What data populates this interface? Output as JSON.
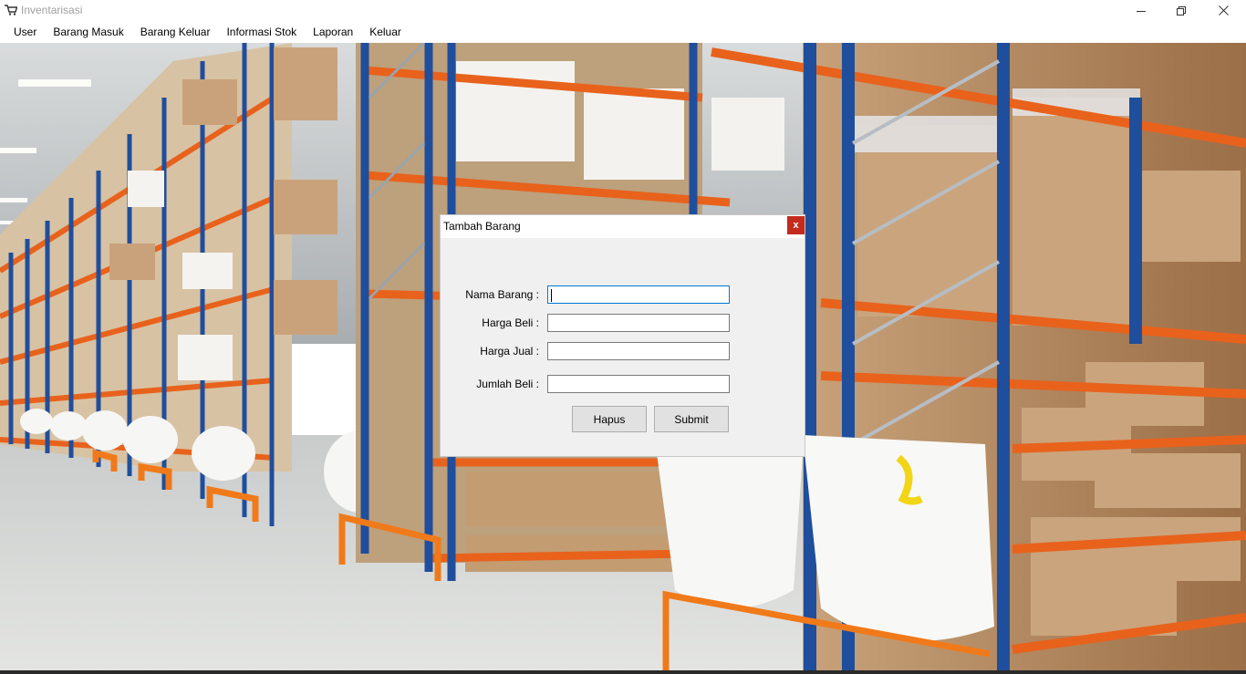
{
  "window": {
    "title": "Inventarisasi",
    "icon": "cart-icon",
    "controls": [
      "minimize-icon",
      "restore-icon",
      "close-icon"
    ]
  },
  "menu": {
    "items": [
      {
        "label": "User"
      },
      {
        "label": "Barang Masuk"
      },
      {
        "label": "Barang Keluar"
      },
      {
        "label": "Informasi Stok"
      },
      {
        "label": "Laporan"
      },
      {
        "label": "Keluar"
      }
    ]
  },
  "background": {
    "description_icon": "warehouse-background-image"
  },
  "dialog": {
    "title": "Tambah Barang",
    "close_label": "x",
    "fields": [
      {
        "label": "Nama Barang :",
        "value": "",
        "focused": true
      },
      {
        "label": "Harga Beli :",
        "value": ""
      },
      {
        "label": "Harga Jual :",
        "value": ""
      },
      {
        "label": "Jumlah Beli :",
        "value": ""
      }
    ],
    "buttons": {
      "hapus": "Hapus",
      "submit": "Submit"
    }
  },
  "colors": {
    "close_red": "#c42b1c",
    "focus_blue": "#0078d7",
    "rack_blue": "#1f4e9c",
    "beam_orange": "#e8621c"
  }
}
